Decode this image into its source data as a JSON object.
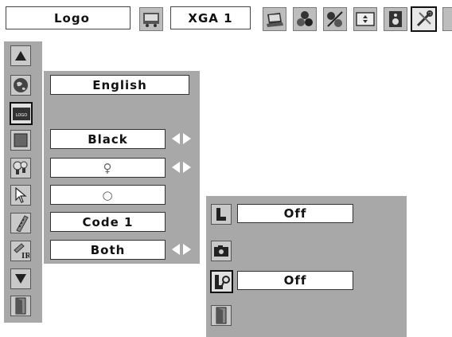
{
  "top_bar": {
    "menu_label": "Logo",
    "signal_label": "XGA 1"
  },
  "main_menu": {
    "language_value": "English",
    "background_value": "Black",
    "lamp_value": "♀",
    "standby_value": "○",
    "remote_code_value": "Code 1",
    "ir_value": "Both"
  },
  "submenu": {
    "logo_value": "Off",
    "pin_code_lock_value": "Off"
  },
  "colors": {
    "panel_gray": "#a8a8a8",
    "icon_gray": "#c9c9c9",
    "box_white": "#ffffff",
    "border_dark": "#222222"
  }
}
